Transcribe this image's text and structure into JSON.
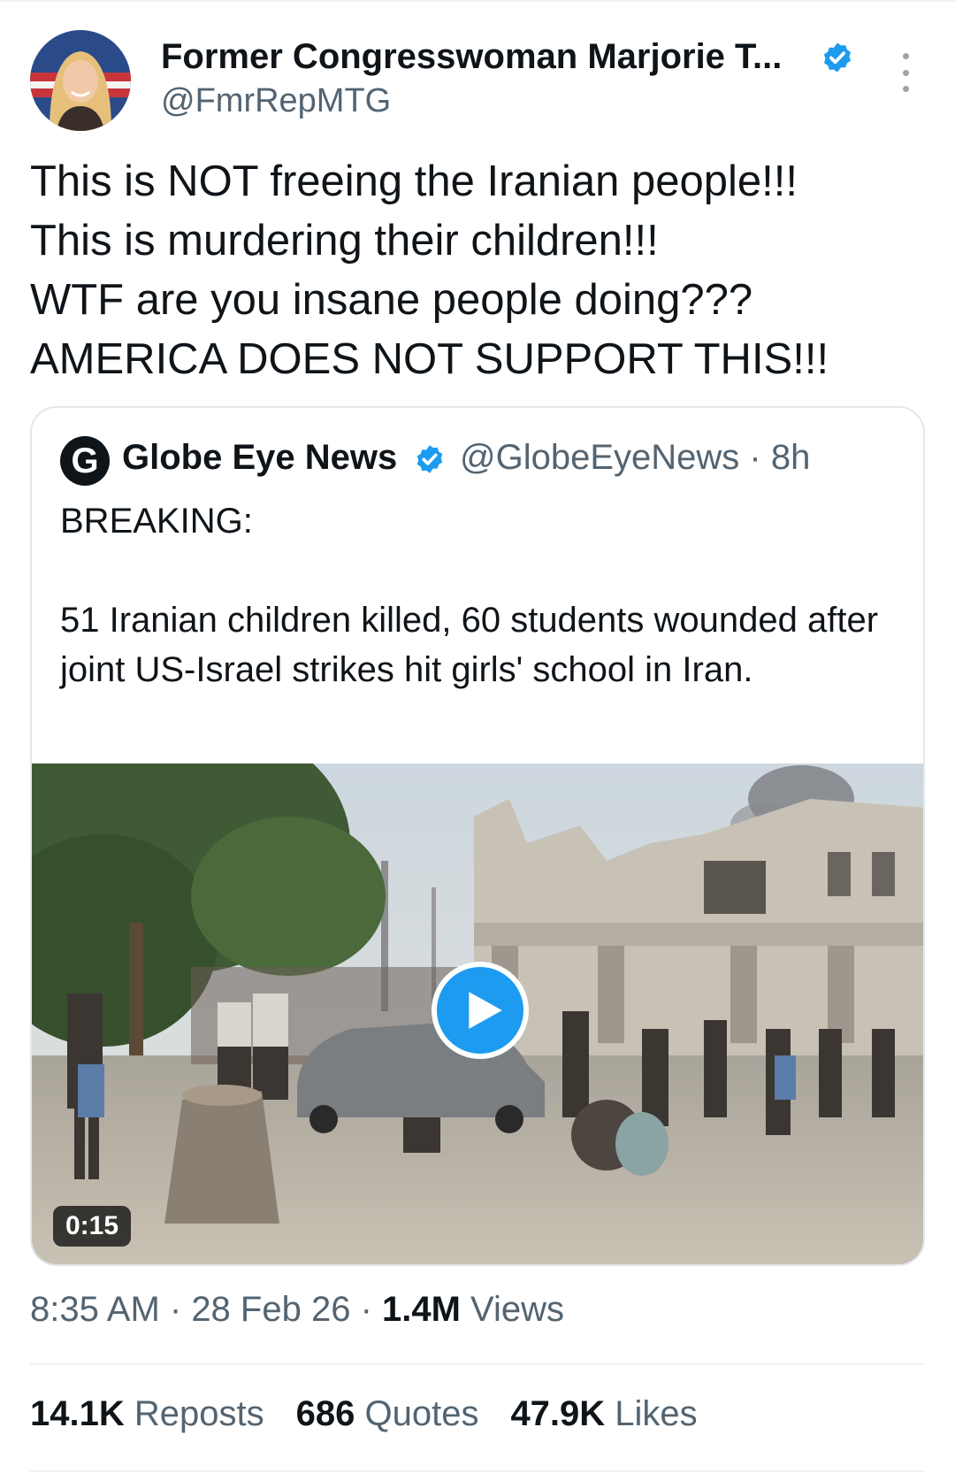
{
  "author": {
    "name": "Former Congresswoman Marjorie T...",
    "handle": "@FmrRepMTG",
    "verified": true
  },
  "tweet": {
    "lines": [
      "This is NOT freeing the Iranian people!!!",
      "This is murdering their children!!!",
      "WTF are you insane people doing???",
      "AMERICA DOES NOT SUPPORT THIS!!!"
    ]
  },
  "quote": {
    "logo_letter": "G",
    "name": "Globe Eye News",
    "handle_time": "@GlobeEyeNews · 8h",
    "verified": true,
    "heading": "BREAKING:",
    "body": "51 Iranian children killed, 60 students wounded after joint US-Israel strikes hit girls' school in Iran.",
    "video": {
      "duration": "0:15",
      "play_icon": "play-icon"
    }
  },
  "meta": {
    "time": "8:35 AM",
    "sep1": " · ",
    "date": "28 Feb 26",
    "sep2": " · ",
    "views_count": "1.4M",
    "views_label": " Views"
  },
  "stats": {
    "reposts_count": "14.1K",
    "reposts_label": " Reposts",
    "quotes_count": "686",
    "quotes_label": " Quotes",
    "likes_count": "47.9K",
    "likes_label": " Likes"
  },
  "colors": {
    "verified": "#1d9bf0",
    "primary_text": "#0f1419",
    "secondary_text": "#536471",
    "border": "#e1e8ed"
  }
}
